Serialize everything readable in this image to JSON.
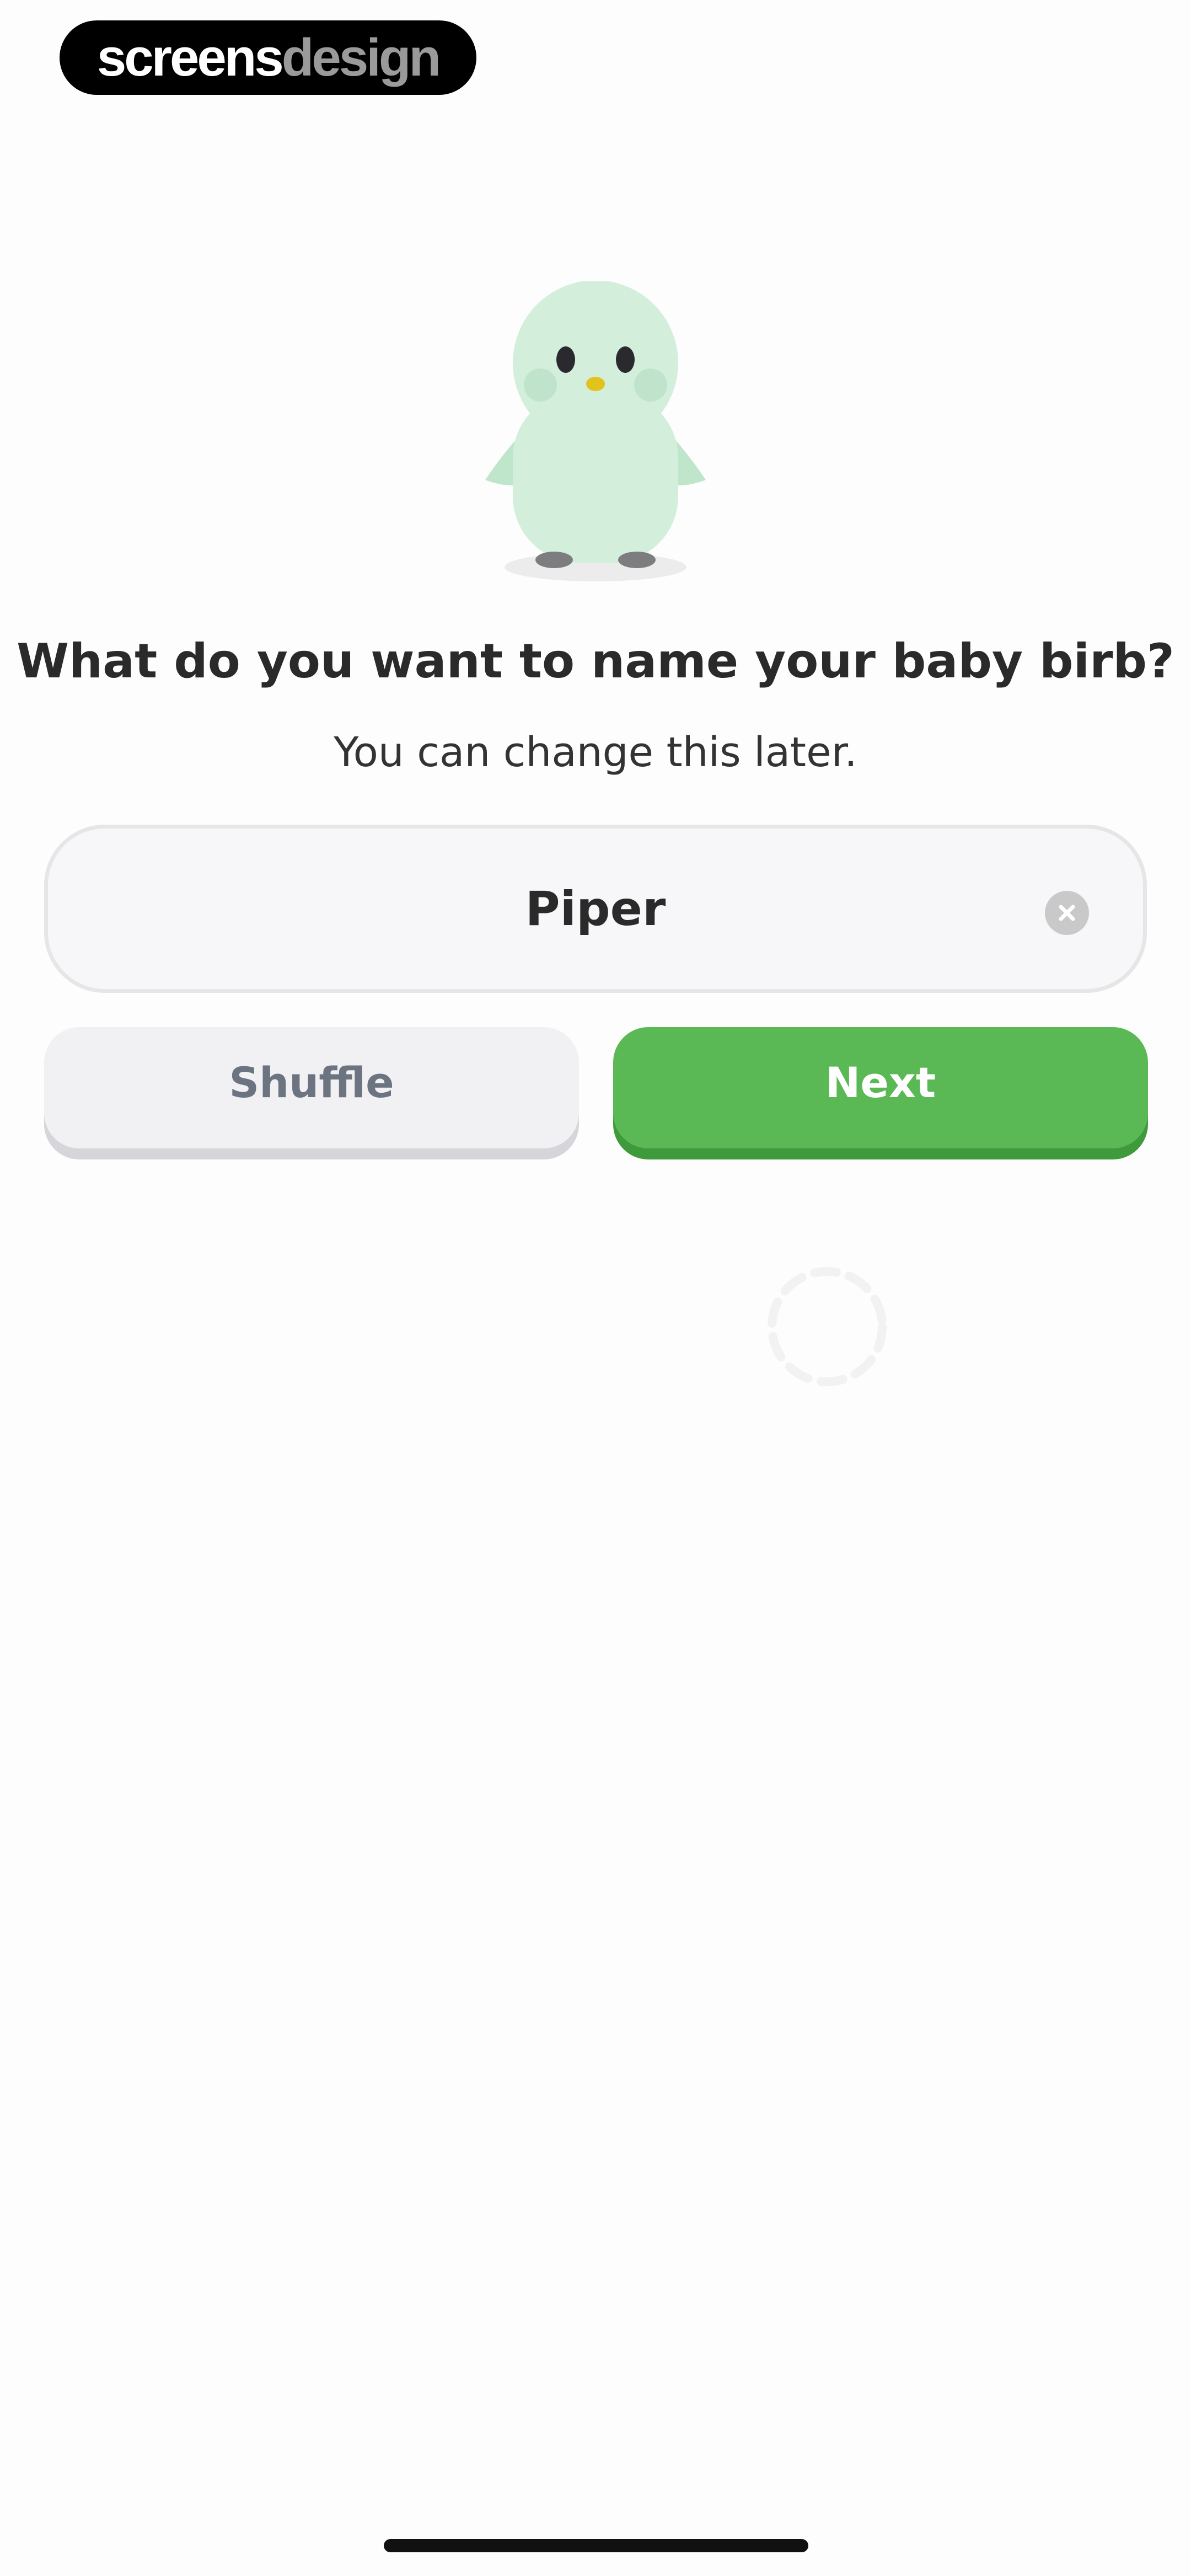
{
  "watermark": {
    "part1": "screens",
    "part2": "design"
  },
  "prompt": {
    "title": "What do you want to name your baby birb?",
    "subtitle": "You can change this later."
  },
  "name_field": {
    "value": "Piper"
  },
  "actions": {
    "shuffle_label": "Shuffle",
    "next_label": "Next"
  },
  "colors": {
    "accent_green": "#5ab955",
    "mascot_green": "#d3efdc"
  },
  "icons": {
    "clear": "clear-circle-x-icon",
    "mascot": "bird-mascot",
    "loading": "loading-spinner"
  }
}
